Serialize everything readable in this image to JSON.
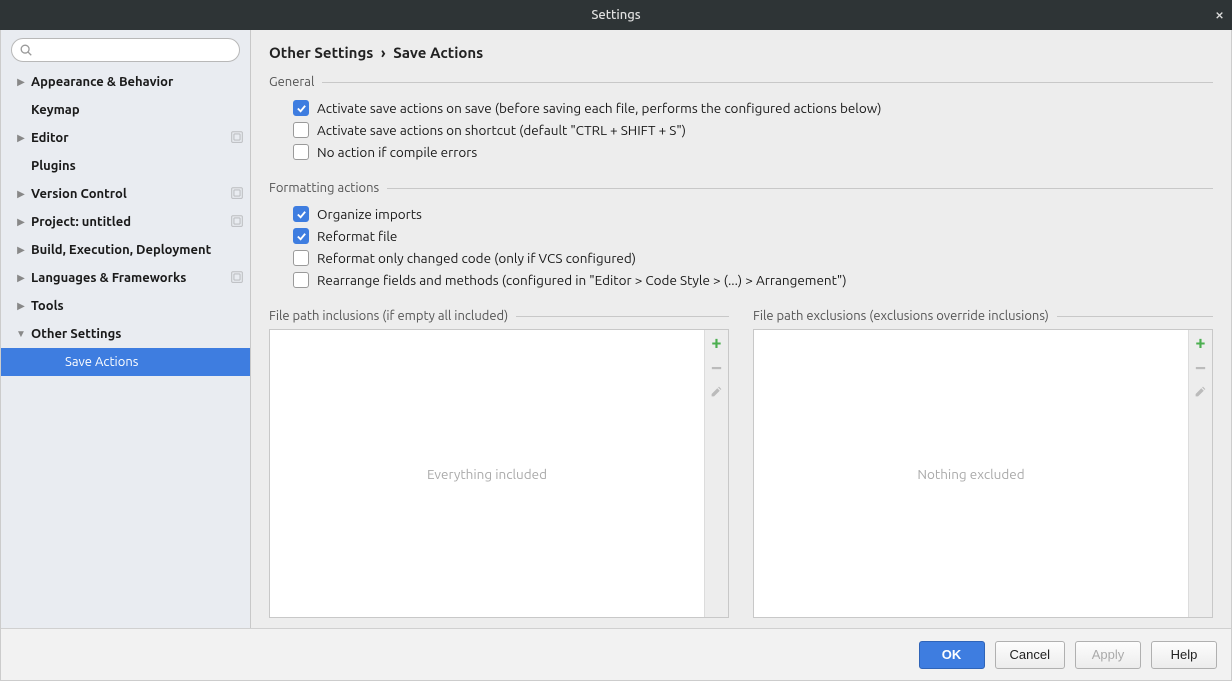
{
  "window": {
    "title": "Settings"
  },
  "search": {
    "placeholder": ""
  },
  "sidebar": {
    "items": [
      {
        "label": "Appearance & Behavior",
        "bold": true,
        "arrow": "right",
        "badge": false
      },
      {
        "label": "Keymap",
        "bold": true,
        "arrow": "",
        "badge": false
      },
      {
        "label": "Editor",
        "bold": true,
        "arrow": "right",
        "badge": true
      },
      {
        "label": "Plugins",
        "bold": true,
        "arrow": "",
        "badge": false
      },
      {
        "label": "Version Control",
        "bold": true,
        "arrow": "right",
        "badge": true
      },
      {
        "label": "Project: untitled",
        "bold": true,
        "arrow": "right",
        "badge": true
      },
      {
        "label": "Build, Execution, Deployment",
        "bold": true,
        "arrow": "right",
        "badge": false
      },
      {
        "label": "Languages & Frameworks",
        "bold": true,
        "arrow": "right",
        "badge": true
      },
      {
        "label": "Tools",
        "bold": true,
        "arrow": "right",
        "badge": false
      },
      {
        "label": "Other Settings",
        "bold": true,
        "arrow": "down",
        "badge": false
      },
      {
        "label": "Save Actions",
        "bold": false,
        "arrow": "",
        "badge": false,
        "child": true,
        "selected": true
      }
    ]
  },
  "breadcrumb": {
    "a": "Other Settings",
    "sep": "›",
    "b": "Save Actions"
  },
  "sections": {
    "general": {
      "title": "General",
      "items": [
        {
          "checked": true,
          "label": "Activate save actions on save (before saving each file, performs the configured actions below)"
        },
        {
          "checked": false,
          "label": "Activate save actions on shortcut (default \"CTRL + SHIFT + S\")"
        },
        {
          "checked": false,
          "label": "No action if compile errors"
        }
      ]
    },
    "formatting": {
      "title": "Formatting actions",
      "items": [
        {
          "checked": true,
          "label": "Organize imports"
        },
        {
          "checked": true,
          "label": "Reformat file"
        },
        {
          "checked": false,
          "label": "Reformat only changed code (only if VCS configured)"
        },
        {
          "checked": false,
          "label": "Rearrange fields and methods (configured in \"Editor > Code Style > (...) > Arrangement\")"
        }
      ]
    }
  },
  "inclusions": {
    "title": "File path inclusions (if empty all included)",
    "placeholder": "Everything included"
  },
  "exclusions": {
    "title": "File path exclusions (exclusions override inclusions)",
    "placeholder": "Nothing excluded"
  },
  "buttons": {
    "ok": "OK",
    "cancel": "Cancel",
    "apply": "Apply",
    "help": "Help"
  }
}
